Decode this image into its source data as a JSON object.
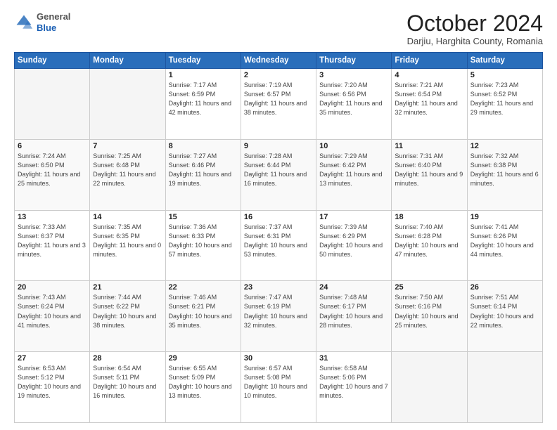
{
  "header": {
    "logo_general": "General",
    "logo_blue": "Blue",
    "month_title": "October 2024",
    "location": "Darjiu, Harghita County, Romania"
  },
  "days_of_week": [
    "Sunday",
    "Monday",
    "Tuesday",
    "Wednesday",
    "Thursday",
    "Friday",
    "Saturday"
  ],
  "weeks": [
    [
      {
        "num": "",
        "detail": ""
      },
      {
        "num": "",
        "detail": ""
      },
      {
        "num": "1",
        "detail": "Sunrise: 7:17 AM\nSunset: 6:59 PM\nDaylight: 11 hours and 42 minutes."
      },
      {
        "num": "2",
        "detail": "Sunrise: 7:19 AM\nSunset: 6:57 PM\nDaylight: 11 hours and 38 minutes."
      },
      {
        "num": "3",
        "detail": "Sunrise: 7:20 AM\nSunset: 6:56 PM\nDaylight: 11 hours and 35 minutes."
      },
      {
        "num": "4",
        "detail": "Sunrise: 7:21 AM\nSunset: 6:54 PM\nDaylight: 11 hours and 32 minutes."
      },
      {
        "num": "5",
        "detail": "Sunrise: 7:23 AM\nSunset: 6:52 PM\nDaylight: 11 hours and 29 minutes."
      }
    ],
    [
      {
        "num": "6",
        "detail": "Sunrise: 7:24 AM\nSunset: 6:50 PM\nDaylight: 11 hours and 25 minutes."
      },
      {
        "num": "7",
        "detail": "Sunrise: 7:25 AM\nSunset: 6:48 PM\nDaylight: 11 hours and 22 minutes."
      },
      {
        "num": "8",
        "detail": "Sunrise: 7:27 AM\nSunset: 6:46 PM\nDaylight: 11 hours and 19 minutes."
      },
      {
        "num": "9",
        "detail": "Sunrise: 7:28 AM\nSunset: 6:44 PM\nDaylight: 11 hours and 16 minutes."
      },
      {
        "num": "10",
        "detail": "Sunrise: 7:29 AM\nSunset: 6:42 PM\nDaylight: 11 hours and 13 minutes."
      },
      {
        "num": "11",
        "detail": "Sunrise: 7:31 AM\nSunset: 6:40 PM\nDaylight: 11 hours and 9 minutes."
      },
      {
        "num": "12",
        "detail": "Sunrise: 7:32 AM\nSunset: 6:38 PM\nDaylight: 11 hours and 6 minutes."
      }
    ],
    [
      {
        "num": "13",
        "detail": "Sunrise: 7:33 AM\nSunset: 6:37 PM\nDaylight: 11 hours and 3 minutes."
      },
      {
        "num": "14",
        "detail": "Sunrise: 7:35 AM\nSunset: 6:35 PM\nDaylight: 11 hours and 0 minutes."
      },
      {
        "num": "15",
        "detail": "Sunrise: 7:36 AM\nSunset: 6:33 PM\nDaylight: 10 hours and 57 minutes."
      },
      {
        "num": "16",
        "detail": "Sunrise: 7:37 AM\nSunset: 6:31 PM\nDaylight: 10 hours and 53 minutes."
      },
      {
        "num": "17",
        "detail": "Sunrise: 7:39 AM\nSunset: 6:29 PM\nDaylight: 10 hours and 50 minutes."
      },
      {
        "num": "18",
        "detail": "Sunrise: 7:40 AM\nSunset: 6:28 PM\nDaylight: 10 hours and 47 minutes."
      },
      {
        "num": "19",
        "detail": "Sunrise: 7:41 AM\nSunset: 6:26 PM\nDaylight: 10 hours and 44 minutes."
      }
    ],
    [
      {
        "num": "20",
        "detail": "Sunrise: 7:43 AM\nSunset: 6:24 PM\nDaylight: 10 hours and 41 minutes."
      },
      {
        "num": "21",
        "detail": "Sunrise: 7:44 AM\nSunset: 6:22 PM\nDaylight: 10 hours and 38 minutes."
      },
      {
        "num": "22",
        "detail": "Sunrise: 7:46 AM\nSunset: 6:21 PM\nDaylight: 10 hours and 35 minutes."
      },
      {
        "num": "23",
        "detail": "Sunrise: 7:47 AM\nSunset: 6:19 PM\nDaylight: 10 hours and 32 minutes."
      },
      {
        "num": "24",
        "detail": "Sunrise: 7:48 AM\nSunset: 6:17 PM\nDaylight: 10 hours and 28 minutes."
      },
      {
        "num": "25",
        "detail": "Sunrise: 7:50 AM\nSunset: 6:16 PM\nDaylight: 10 hours and 25 minutes."
      },
      {
        "num": "26",
        "detail": "Sunrise: 7:51 AM\nSunset: 6:14 PM\nDaylight: 10 hours and 22 minutes."
      }
    ],
    [
      {
        "num": "27",
        "detail": "Sunrise: 6:53 AM\nSunset: 5:12 PM\nDaylight: 10 hours and 19 minutes."
      },
      {
        "num": "28",
        "detail": "Sunrise: 6:54 AM\nSunset: 5:11 PM\nDaylight: 10 hours and 16 minutes."
      },
      {
        "num": "29",
        "detail": "Sunrise: 6:55 AM\nSunset: 5:09 PM\nDaylight: 10 hours and 13 minutes."
      },
      {
        "num": "30",
        "detail": "Sunrise: 6:57 AM\nSunset: 5:08 PM\nDaylight: 10 hours and 10 minutes."
      },
      {
        "num": "31",
        "detail": "Sunrise: 6:58 AM\nSunset: 5:06 PM\nDaylight: 10 hours and 7 minutes."
      },
      {
        "num": "",
        "detail": ""
      },
      {
        "num": "",
        "detail": ""
      }
    ]
  ]
}
